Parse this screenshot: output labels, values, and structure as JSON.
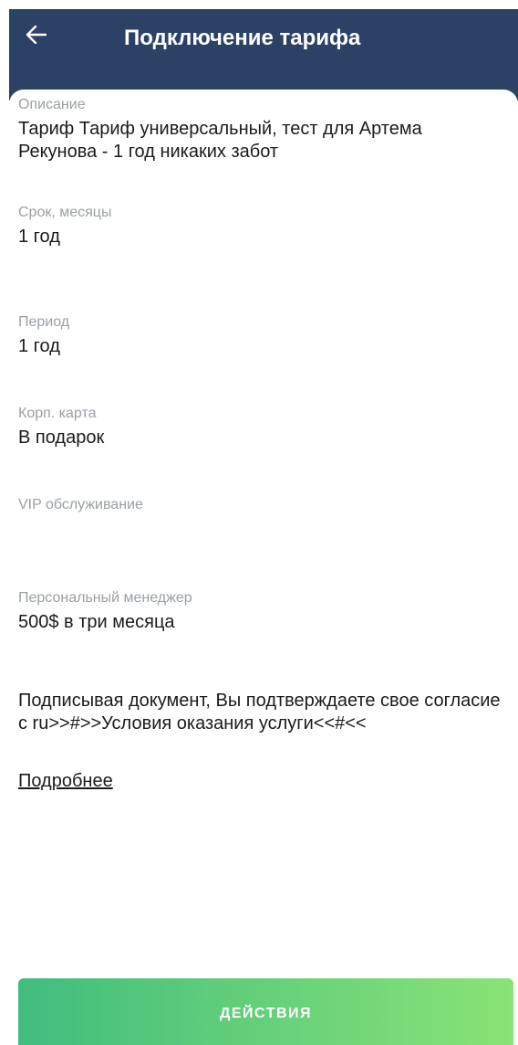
{
  "header": {
    "back_icon": "arrow-left-icon",
    "title": "Подключение тарифа"
  },
  "colors": {
    "header_bg": "#2c4166",
    "button_gradient_start": "#41bd7e",
    "button_gradient_end": "#8ae376",
    "label": "#9aa0a6",
    "value": "#1b1b1b"
  },
  "fields": {
    "description": {
      "label": "Описание",
      "value": "Тариф Тариф универсальный, тест для Артема Рекунова - 1 год никаких забот"
    },
    "term": {
      "label": "Срок, месяцы",
      "value": "1 год"
    },
    "period": {
      "label": "Период",
      "value": "1 год"
    },
    "corp_card": {
      "label": "Корп. карта",
      "value": "В подарок"
    },
    "vip": {
      "label": "VIP обслуживание",
      "value": ""
    },
    "manager": {
      "label": "Персональный менеджер",
      "value": "500$ в три месяца"
    }
  },
  "consent": {
    "text": "Подписывая документ, Вы подтверждаете свое согласие с ru>>#>>Условия оказания услуги<<#<<",
    "more_link": "Подробнее"
  },
  "actions": {
    "button_label": "ДЕЙСТВИЯ"
  }
}
